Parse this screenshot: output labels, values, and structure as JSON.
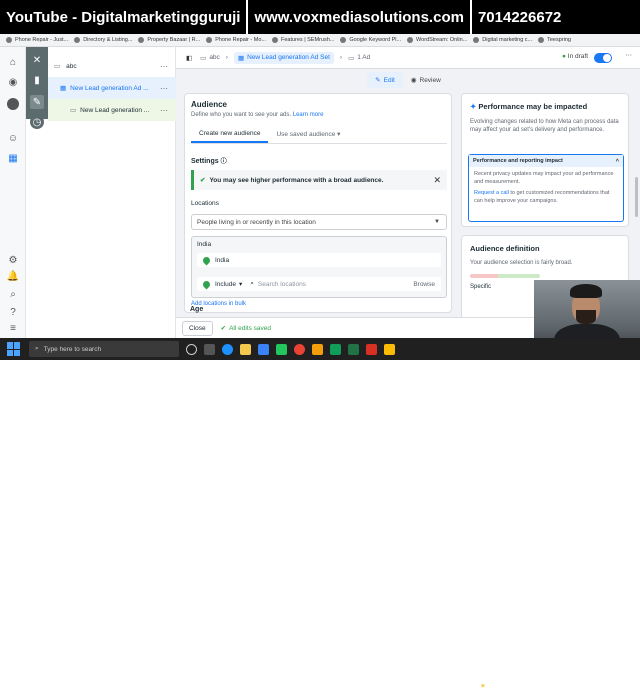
{
  "banner": {
    "segments": [
      "YouTube - Digitalmarketingguruji",
      "www.voxmediasolutions.com",
      "7014226672"
    ]
  },
  "bookmarks": [
    "Phone Repair - Just...",
    "Directory & Listing...",
    "Property Bazaar | R...",
    "Phone Repair - Mo...",
    "Features | SEMrush...",
    "Google Keyword Pl...",
    "WordStream: Onlin...",
    "Digital marketing c...",
    "Teespring"
  ],
  "tree": {
    "campaign": "abc",
    "adset": "New Lead generation Ad ...",
    "ad": "New Lead generation ..."
  },
  "topbar": {
    "crumbs": [
      "abc",
      "New Lead generation Ad Set",
      "1 Ad"
    ],
    "status": "In draft"
  },
  "tabs": {
    "edit": "Edit",
    "review": "Review"
  },
  "audience": {
    "title": "Audience",
    "subtitle": "Define who you want to see your ads.",
    "learn_more": "Learn more",
    "tab_create": "Create new audience",
    "tab_saved": "Use saved audience",
    "settings_label": "Settings",
    "notice": "You may see higher performance with a broad audience.",
    "locations_label": "Locations",
    "locations_select": "People living in or recently in this location",
    "country_header": "India",
    "country_item": "India",
    "include_label": "Include",
    "search_placeholder": "Search locations",
    "browse": "Browse",
    "add_bulk": "Add locations in bulk",
    "age_label": "Age"
  },
  "right": {
    "perf_title": "Performance may be impacted",
    "perf_body": "Evolving changes related to how Meta can process data may affect your ad set's delivery and performance.",
    "reporting_title": "Performance and reporting impact",
    "reporting_body": "Recent privacy updates may impact your ad performance and measurement.",
    "request_link": "Request a call",
    "request_rest": " to get customized recommendations that can help improve your campaigns.",
    "def_title": "Audience definition",
    "def_body": "Your audience selection is fairly broad.",
    "specific": "Specific"
  },
  "bottom": {
    "close": "Close",
    "saved": "All edits saved"
  },
  "taskbar": {
    "search": "Type here to search",
    "temp": "31°C"
  },
  "colors": {
    "accent": "#1877f2",
    "success": "#31a24c"
  }
}
